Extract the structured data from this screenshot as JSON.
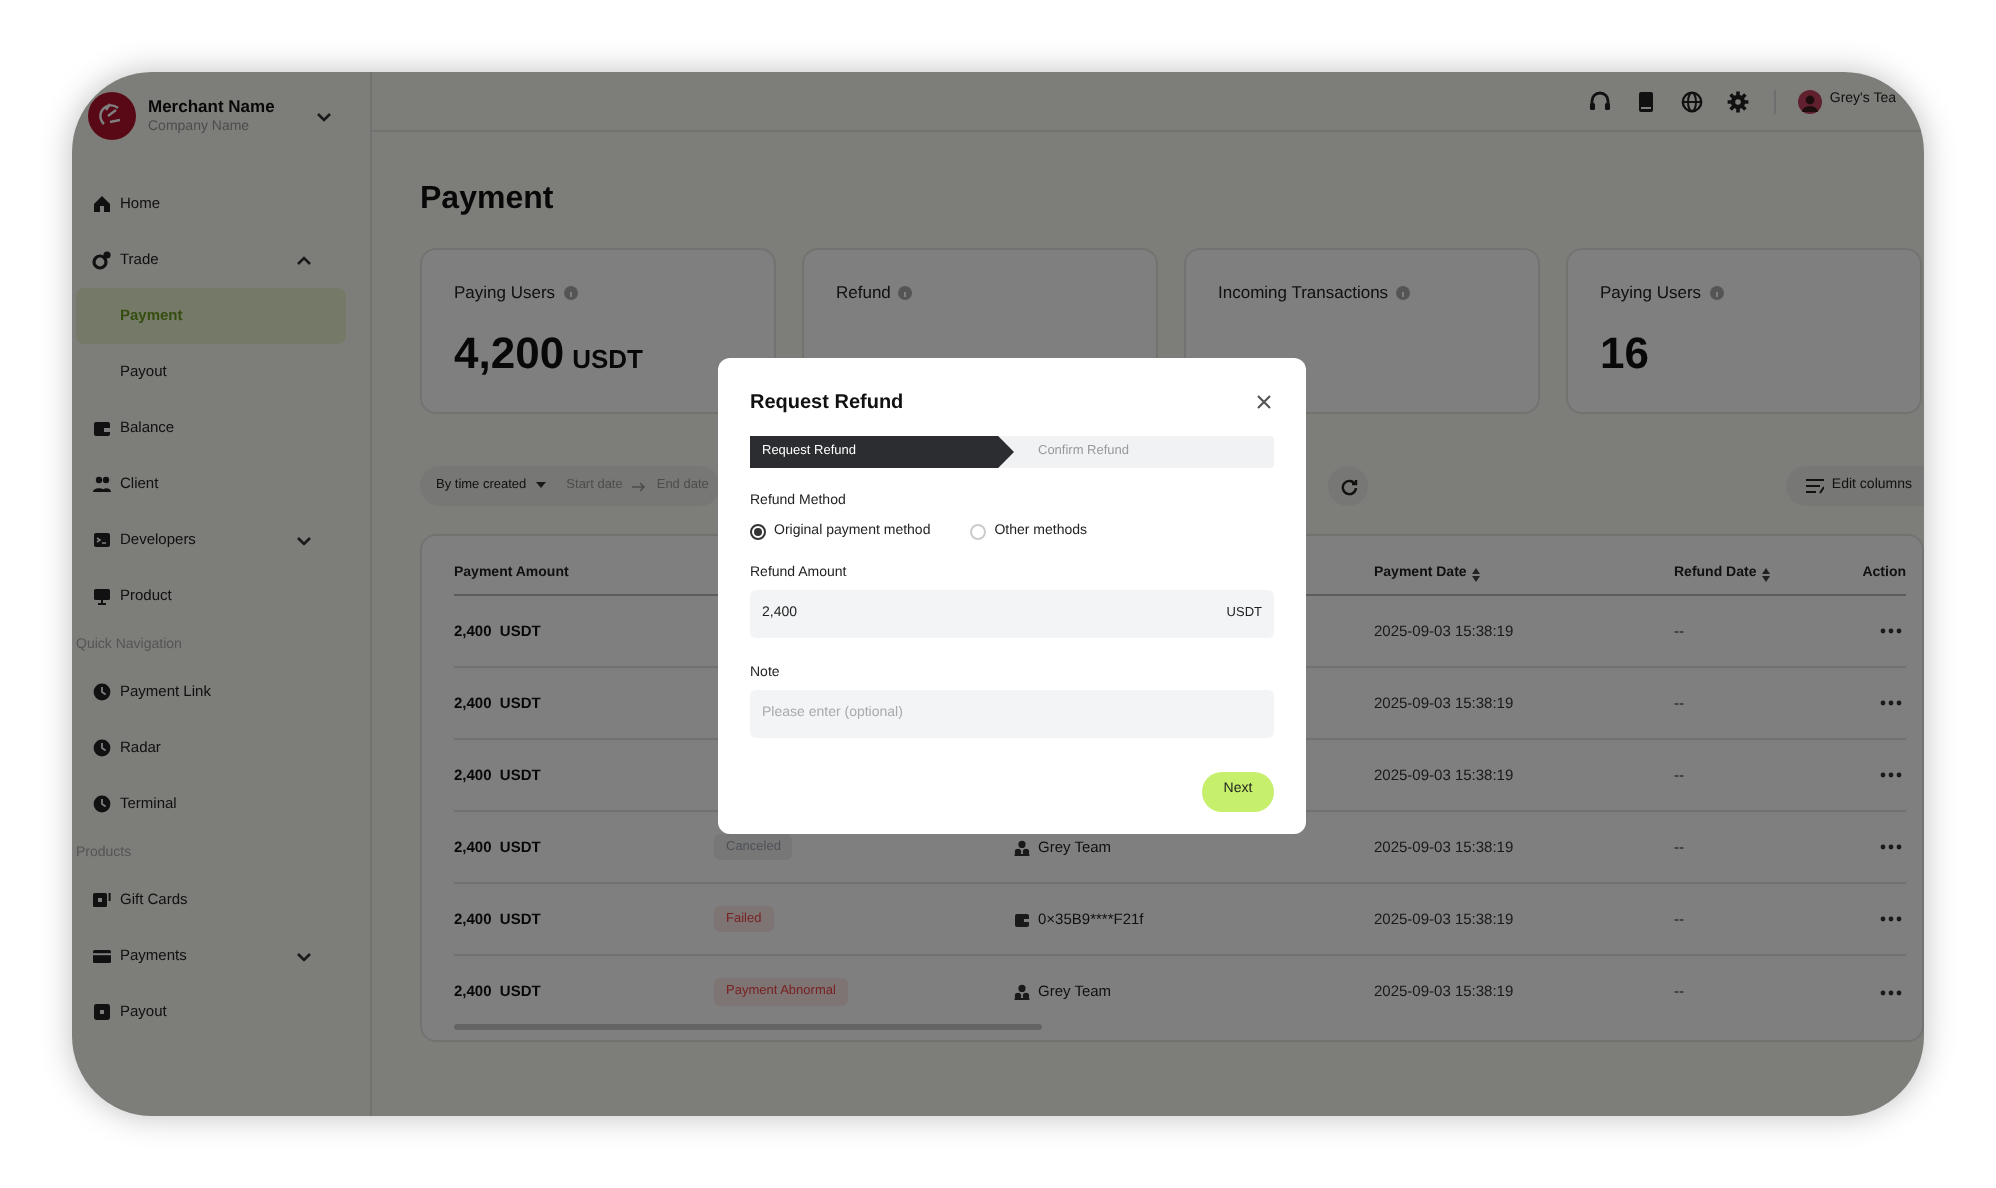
{
  "sidebar": {
    "merchant": {
      "name": "Merchant Name",
      "company": "Company Name"
    },
    "sections": [
      {
        "items": [
          {
            "label": "Home",
            "selected": false
          },
          {
            "label": "Trade",
            "selected": false,
            "expanded": true,
            "children": [
              {
                "label": "Payment",
                "selected": true
              },
              {
                "label": "Payout",
                "selected": false
              }
            ]
          },
          {
            "label": "Balance",
            "selected": false
          },
          {
            "label": "Client",
            "selected": false
          },
          {
            "label": "Developers",
            "selected": false,
            "expanded": false
          },
          {
            "label": "Product",
            "selected": false
          }
        ]
      },
      {
        "title": "Quick Navigation",
        "items": [
          {
            "label": "Payment Link",
            "selected": false
          },
          {
            "label": "Radar",
            "selected": false
          },
          {
            "label": "Terminal",
            "selected": false
          }
        ]
      },
      {
        "title": "Products",
        "items": [
          {
            "label": "Gift Cards",
            "selected": false
          },
          {
            "label": "Payments",
            "selected": false,
            "expanded": false
          },
          {
            "label": "Payout",
            "selected": false
          }
        ]
      }
    ]
  },
  "top_bar": {
    "user": "Grey's Tea"
  },
  "page_title": "Payment",
  "summary_cards": [
    {
      "label": "Paying Users",
      "value": "4,200",
      "unit": "USDT"
    },
    {
      "label": "Refund"
    },
    {
      "label": "Incoming Transactions"
    },
    {
      "label": "Paying Users",
      "value": "16"
    }
  ],
  "filters": {
    "time_filter": "By time created",
    "start_date": "Start date",
    "end_date": "End date"
  },
  "edit_columns": "Edit columns",
  "table": {
    "columns": {
      "payment_amount": {
        "label": "Payment Amount",
        "sortable": false
      },
      "payment_date": {
        "label": "Payment Date",
        "sortable": true
      },
      "refund_date": {
        "label": "Refund Date",
        "sortable": true
      },
      "action": {
        "label": "Action",
        "sortable": false
      }
    },
    "rows": [
      {
        "amount": "2,400",
        "currency": "USDT",
        "payment_date": "2025-09-03 15:38:19",
        "refund_date": "--"
      },
      {
        "amount": "2,400",
        "currency": "USDT",
        "payment_date": "2025-09-03 15:38:19",
        "refund_date": "--"
      },
      {
        "amount": "2,400",
        "currency": "USDT",
        "payment_date": "2025-09-03 15:38:19",
        "refund_date": "--"
      },
      {
        "amount": "2,400",
        "currency": "USDT",
        "status": {
          "label": "Canceled",
          "kind": "neutral"
        },
        "account": {
          "kind": "team",
          "label": "Grey Team"
        },
        "payment_date": "2025-09-03 15:38:19",
        "refund_date": "--"
      },
      {
        "amount": "2,400",
        "currency": "USDT",
        "status": {
          "label": "Failed",
          "kind": "danger"
        },
        "account": {
          "kind": "wallet",
          "label": "0×35B9****F21f"
        },
        "payment_date": "2025-09-03 15:38:19",
        "refund_date": "--"
      },
      {
        "amount": "2,400",
        "currency": "USDT",
        "status": {
          "label": "Payment Abnormal",
          "kind": "danger"
        },
        "account": {
          "kind": "team",
          "label": "Grey Team"
        },
        "payment_date": "2025-09-03 15:38:19",
        "refund_date": "--"
      }
    ]
  },
  "dialog": {
    "title": "Request Refund",
    "steps": [
      {
        "label": "Request Refund",
        "selected": true
      },
      {
        "label": "Confirm Refund",
        "selected": false
      }
    ],
    "refund_method": {
      "label": "Refund Method",
      "options": [
        {
          "label": "Original payment method",
          "selected": true
        },
        {
          "label": "Other methods",
          "selected": false
        }
      ]
    },
    "refund_amount": {
      "label": "Refund Amount",
      "value": "2,400",
      "unit": "USDT"
    },
    "note": {
      "label": "Note",
      "placeholder": "Please enter (optional)"
    },
    "next_button": "Next"
  }
}
